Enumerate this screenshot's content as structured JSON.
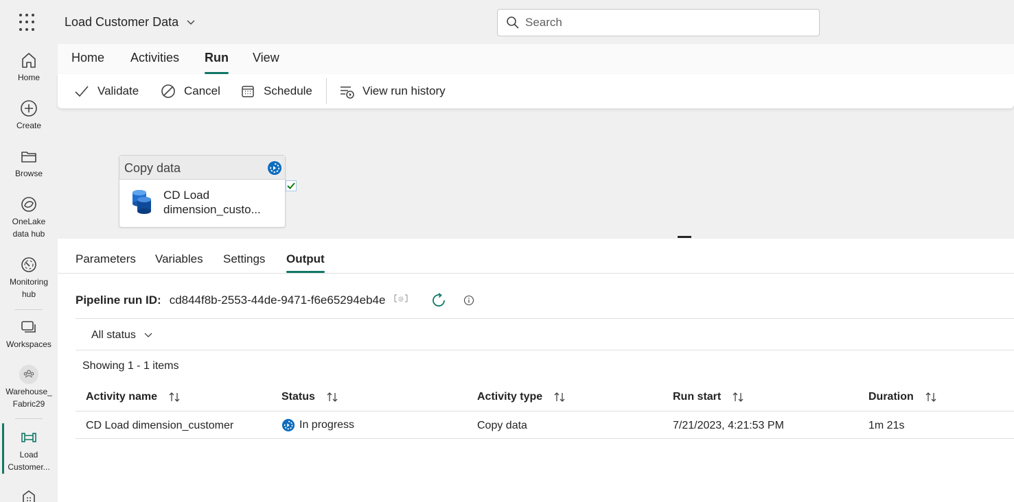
{
  "app": {
    "document_title": "Load Customer Data"
  },
  "search": {
    "placeholder": "Search"
  },
  "rail": {
    "items": [
      {
        "label": "Home",
        "icon": "home-icon"
      },
      {
        "label": "Create",
        "icon": "plus-circle-icon"
      },
      {
        "label": "Browse",
        "icon": "folder-icon"
      },
      {
        "label": "OneLake data hub",
        "icon": "onelake-icon"
      },
      {
        "label": "Monitoring hub",
        "icon": "monitor-icon"
      },
      {
        "label": "Workspaces",
        "icon": "workspaces-icon"
      },
      {
        "label": "Warehouse_ Fabric29",
        "icon": "workspace-avatar-icon"
      },
      {
        "label": "Load Customer...",
        "icon": "pipeline-icon"
      }
    ]
  },
  "menu": {
    "tabs": [
      "Home",
      "Activities",
      "Run",
      "View"
    ],
    "active": "Run"
  },
  "toolbar": {
    "validate": "Validate",
    "cancel": "Cancel",
    "schedule": "Schedule",
    "view_run_history": "View run history"
  },
  "canvas": {
    "activity": {
      "type": "Copy data",
      "name_line1": "CD Load",
      "name_line2": "dimension_custo..."
    }
  },
  "panel": {
    "tabs": [
      "Parameters",
      "Variables",
      "Settings",
      "Output"
    ],
    "active": "Output",
    "run_id_label": "Pipeline run ID:",
    "run_id": "cd844f8b-2553-44de-9471-f6e65294eb4e",
    "status_filter": "All status",
    "showing": "Showing 1 - 1 items",
    "columns": [
      "Activity name",
      "Status",
      "Activity type",
      "Run start",
      "Duration"
    ],
    "rows": [
      {
        "activity_name": "CD Load dimension_customer",
        "status": "In progress",
        "activity_type": "Copy data",
        "run_start": "7/21/2023, 4:21:53 PM",
        "duration": "1m 21s"
      }
    ]
  },
  "colors": {
    "accent": "#117865",
    "in_progress": "#0f6cbd"
  }
}
